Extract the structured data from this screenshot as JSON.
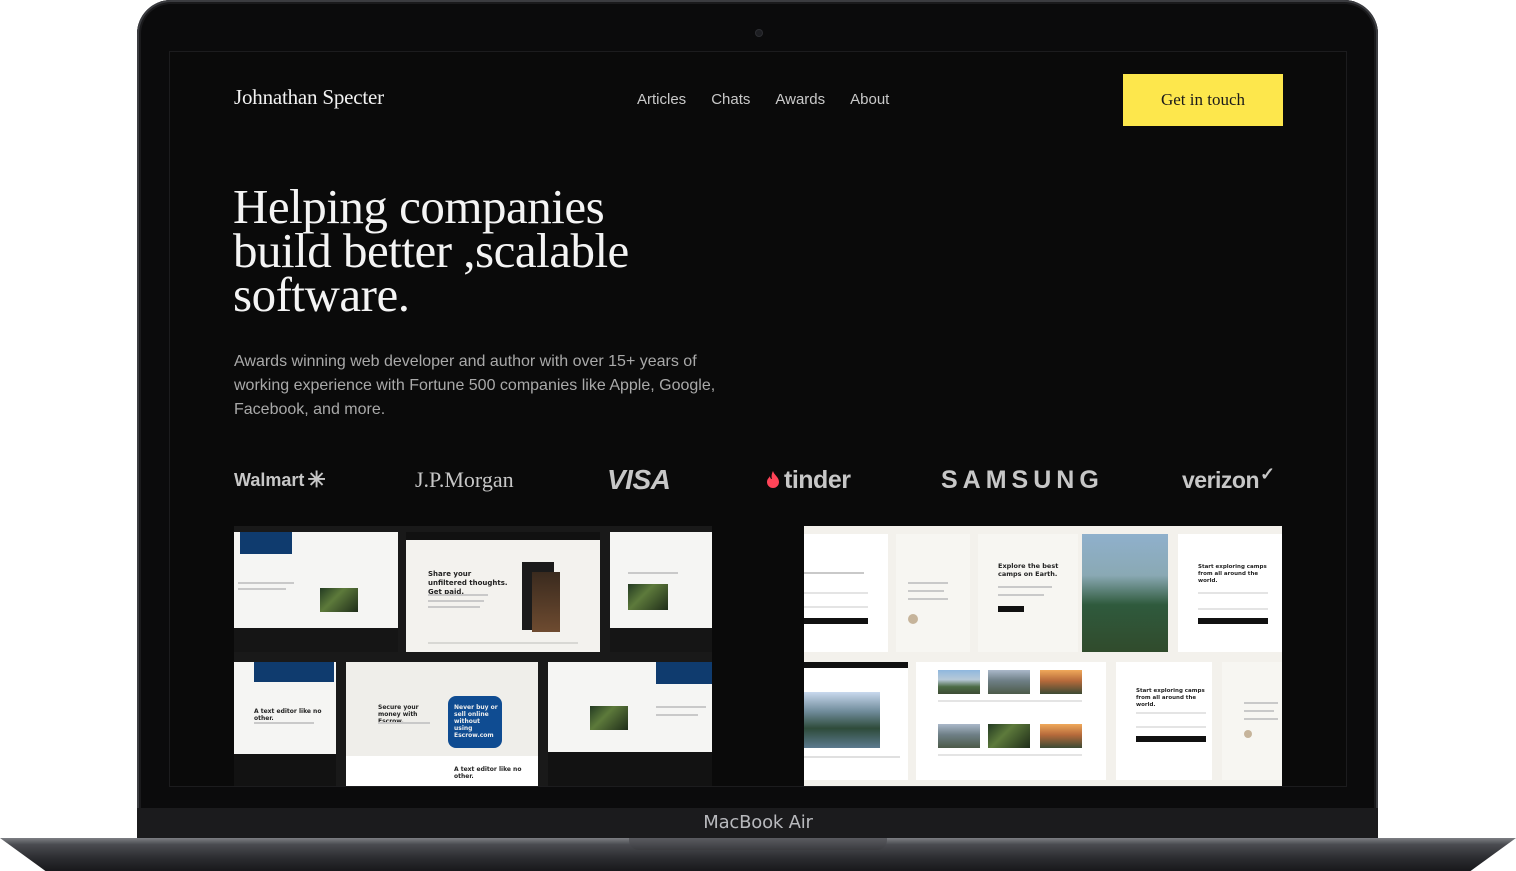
{
  "device": {
    "model_label": "MacBook Air"
  },
  "site": {
    "brand": "Johnathan Specter",
    "nav": [
      "Articles",
      "Chats",
      "Awards",
      "About"
    ],
    "cta_label": "Get in touch"
  },
  "hero": {
    "title_lines": [
      "Helping companies",
      "build better ,scalable",
      "software."
    ],
    "subtitle": "Awards winning web developer and author with over 15+ years of working experience with Fortune 500 companies like Apple, Google, Facebook, and more."
  },
  "logos": {
    "walmart": "Walmart",
    "jpmorgan": "J.P.Morgan",
    "visa": "VISA",
    "tinder": "tinder",
    "samsung": "SAMSUNG",
    "verizon": "verizon"
  },
  "previews": {
    "left": {
      "headline_a": "Share your unfiltered thoughts. Get paid.",
      "headline_b": "Secure your money with Escrow.",
      "headline_c": "Never buy or sell online without using Escrow.com",
      "text_editor": "A text editor like no other."
    },
    "right": {
      "headline_a": "Explore the best camps on Earth.",
      "headline_b": "Start exploring camps from all around the world."
    }
  },
  "colors": {
    "accent": "#fde74c",
    "background": "#0a0a0a",
    "text_primary": "#f4f4f4",
    "text_muted": "#a9a9a9"
  }
}
